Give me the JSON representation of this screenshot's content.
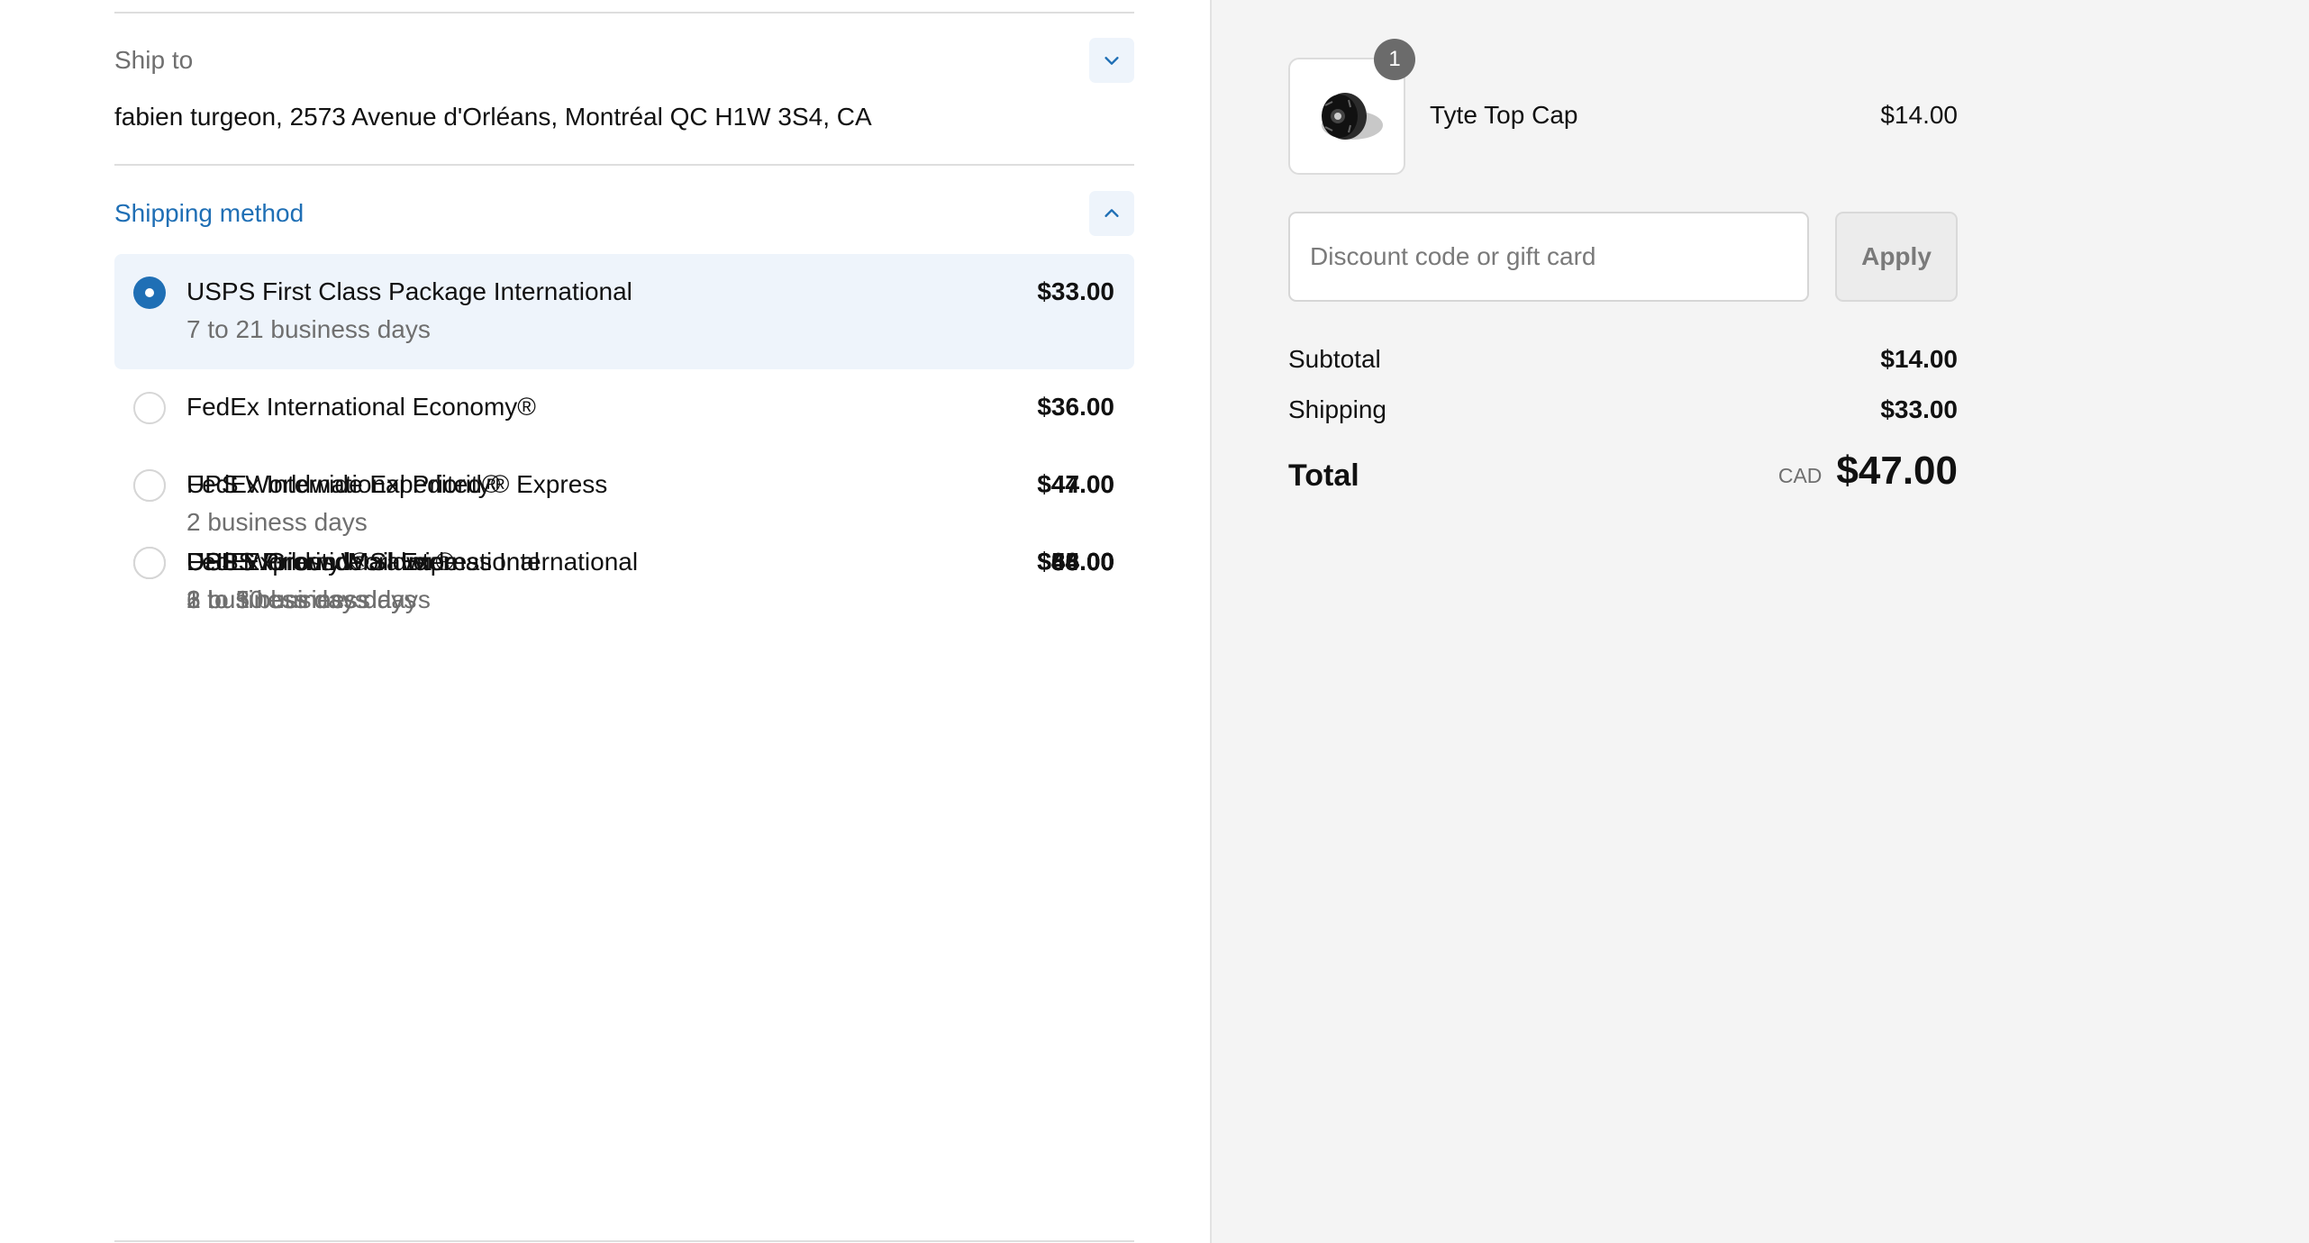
{
  "ship_to": {
    "label": "Ship to",
    "address": "fabien turgeon, 2573 Avenue d'Orléans, Montréal QC H1W 3S4, CA"
  },
  "shipping_method": {
    "label": "Shipping method",
    "selected_index": 0,
    "rates": [
      {
        "name": "USPS First Class Package International",
        "detail": "7 to 21 business days",
        "price": "$33.00"
      },
      {
        "name": "FedEx International Economy®",
        "detail": "",
        "price": "$36.00"
      },
      {
        "name": "UPS Worldwide Expedited®",
        "detail": "2 business days",
        "price": "$44.00"
      },
      {
        "name": "FedEx International Priority® Express",
        "detail": "",
        "price": "$47.00"
      },
      {
        "name": "UPS Worldwide Saver®",
        "detail": "1 business day",
        "price": "$48.00"
      },
      {
        "name": "FedEx Ground®",
        "detail": "2 business days",
        "price": "$54.00"
      },
      {
        "name": "USPS Priority Mail International",
        "detail": "6 to 10 business days",
        "price": "$58.00"
      },
      {
        "name": "DHL Express Worldwide",
        "detail": "1 to 3 business days",
        "price": "$65.00"
      },
      {
        "name": "USPS Priority Mail Express International",
        "detail": "3 to 5 business days",
        "price": "$86.00"
      }
    ]
  },
  "summary": {
    "product": {
      "name": "Tyte Top Cap",
      "price": "$14.00",
      "quantity": "1"
    },
    "discount": {
      "placeholder": "Discount code or gift card",
      "apply_label": "Apply"
    },
    "subtotal_label": "Subtotal",
    "subtotal_value": "$14.00",
    "shipping_label": "Shipping",
    "shipping_value": "$33.00",
    "total_label": "Total",
    "currency": "CAD",
    "total_value": "$47.00"
  },
  "colors": {
    "accent": "#1f6fb5",
    "selected_bg": "#eef4fb",
    "sidebar_bg": "#f4f4f4"
  }
}
